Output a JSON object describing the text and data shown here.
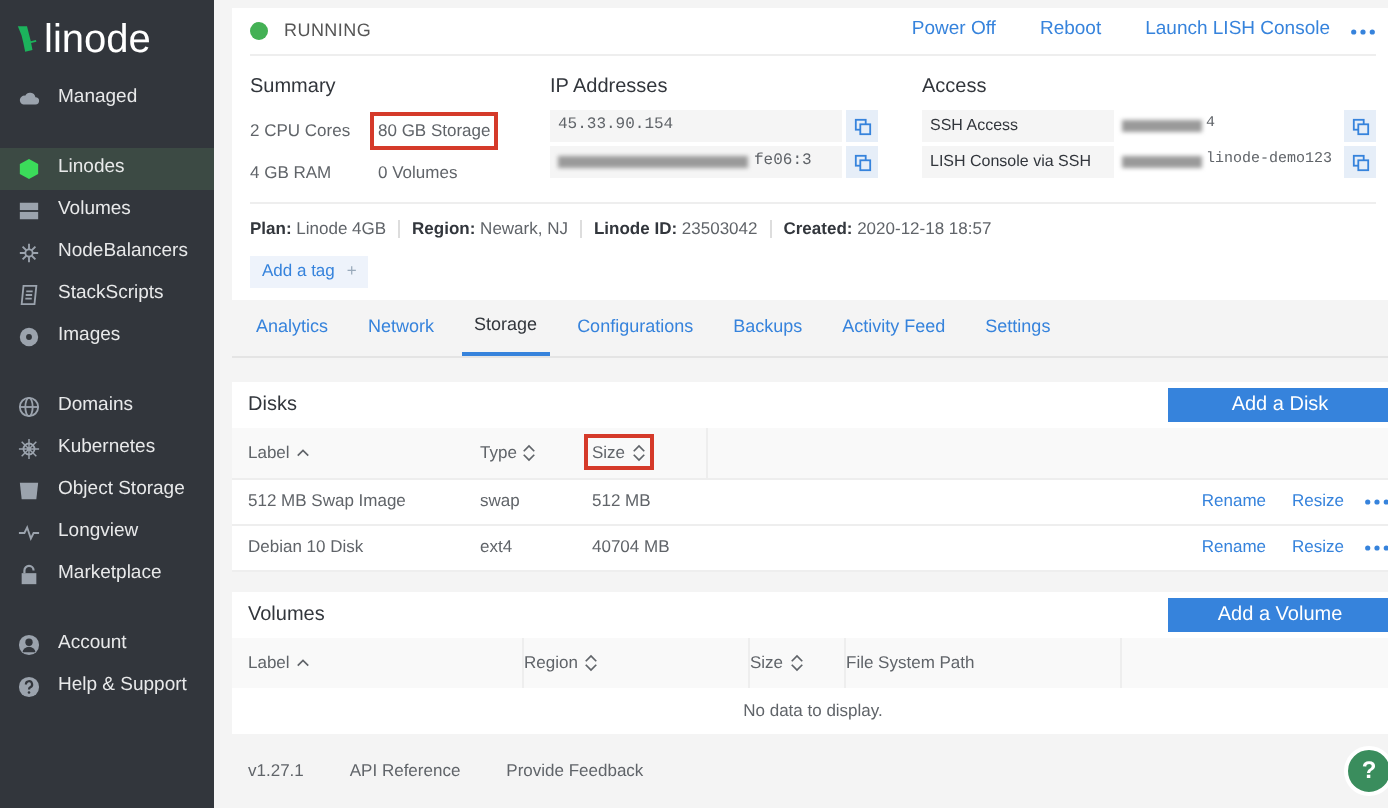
{
  "sidebar": {
    "logo": "linode",
    "groups": [
      [
        {
          "label": "Managed",
          "selected": false
        }
      ],
      [
        {
          "label": "Linodes",
          "selected": true
        },
        {
          "label": "Volumes",
          "selected": false
        },
        {
          "label": "NodeBalancers",
          "selected": false
        },
        {
          "label": "StackScripts",
          "selected": false
        },
        {
          "label": "Images",
          "selected": false
        }
      ],
      [
        {
          "label": "Domains",
          "selected": false
        },
        {
          "label": "Kubernetes",
          "selected": false
        },
        {
          "label": "Object Storage",
          "selected": false
        },
        {
          "label": "Longview",
          "selected": false
        },
        {
          "label": "Marketplace",
          "selected": false
        }
      ],
      [
        {
          "label": "Account",
          "selected": false
        },
        {
          "label": "Help & Support",
          "selected": false
        }
      ]
    ]
  },
  "status": {
    "label": "RUNNING",
    "color": "#44b155"
  },
  "actions": [
    "Power Off",
    "Reboot",
    "Launch LISH Console"
  ],
  "summary": {
    "title": "Summary",
    "items": [
      {
        "text": "2 CPU Cores",
        "highlighted": false
      },
      {
        "text": "80 GB Storage",
        "highlighted": true
      },
      {
        "text": "4 GB RAM",
        "highlighted": false
      },
      {
        "text": "0 Volumes",
        "highlighted": false
      }
    ]
  },
  "ip_addresses": {
    "title": "IP Addresses",
    "rows": [
      {
        "value": "45.33.90.154",
        "redacted": false
      },
      {
        "value": "fe06:3",
        "redacted": true
      }
    ]
  },
  "access": {
    "title": "Access",
    "rows": [
      {
        "label": "SSH Access",
        "value": "4",
        "redacted": true
      },
      {
        "label": "LISH Console via SSH",
        "value": "linode-demo123",
        "redacted": true
      }
    ]
  },
  "details": [
    {
      "key": "Plan:",
      "value": "Linode 4GB"
    },
    {
      "key": "Region:",
      "value": "Newark, NJ"
    },
    {
      "key": "Linode ID:",
      "value": "23503042"
    },
    {
      "key": "Created:",
      "value": "2020-12-18 18:57"
    }
  ],
  "add_tag": {
    "label": "Add a tag",
    "icon": "+"
  },
  "tabs": [
    {
      "label": "Analytics",
      "selected": false
    },
    {
      "label": "Network",
      "selected": false
    },
    {
      "label": "Storage",
      "selected": true
    },
    {
      "label": "Configurations",
      "selected": false
    },
    {
      "label": "Backups",
      "selected": false
    },
    {
      "label": "Activity Feed",
      "selected": false
    },
    {
      "label": "Settings",
      "selected": false
    }
  ],
  "disks": {
    "title": "Disks",
    "button": "Add a Disk",
    "columns": [
      {
        "label": "Label",
        "kind": "sorted",
        "highlighted": false
      },
      {
        "label": "Type",
        "kind": "sortable",
        "highlighted": false
      },
      {
        "label": "Size",
        "kind": "sortable",
        "highlighted": true
      }
    ],
    "rows": [
      {
        "label": "512 MB Swap Image",
        "type": "swap",
        "size": "512 MB",
        "actions": [
          "Rename",
          "Resize"
        ]
      },
      {
        "label": "Debian 10 Disk",
        "type": "ext4",
        "size": "40704 MB",
        "actions": [
          "Rename",
          "Resize"
        ]
      }
    ]
  },
  "volumes": {
    "title": "Volumes",
    "button": "Add a Volume",
    "columns": [
      {
        "label": "Label",
        "kind": "sorted"
      },
      {
        "label": "Region",
        "kind": "sortable"
      },
      {
        "label": "Size",
        "kind": "sortable"
      },
      {
        "label": "File System Path",
        "kind": "plain"
      }
    ],
    "empty": "No data to display."
  },
  "footer": {
    "version": "v1.27.1",
    "links": [
      "API Reference",
      "Provide Feedback"
    ],
    "help": "?"
  }
}
